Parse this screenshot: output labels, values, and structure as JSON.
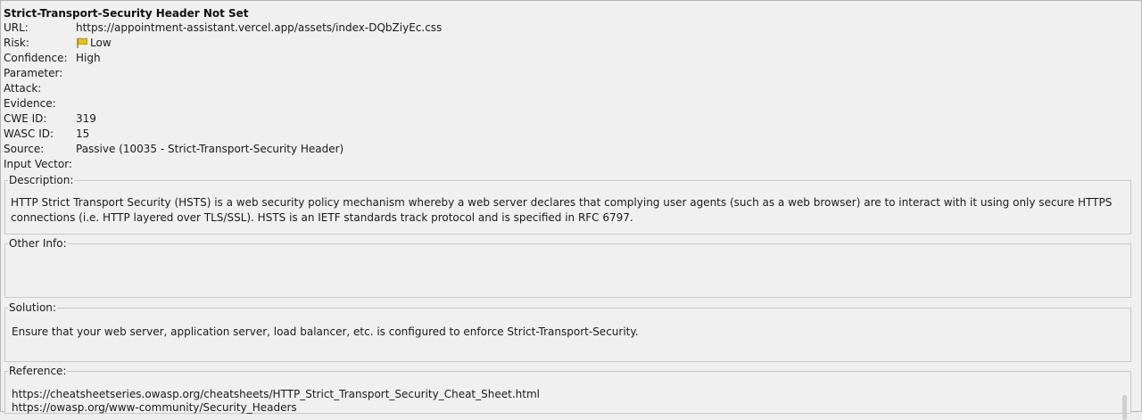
{
  "alert": {
    "title": "Strict-Transport-Security Header Not Set",
    "fields": [
      {
        "label": "URL:",
        "value": "https://appointment-assistant.vercel.app/assets/index-DQbZiyEc.css"
      },
      {
        "label": "Risk:",
        "value": "Low",
        "icon": "yellow-flag-icon"
      },
      {
        "label": "Confidence:",
        "value": "High"
      },
      {
        "label": "Parameter:",
        "value": ""
      },
      {
        "label": "Attack:",
        "value": ""
      },
      {
        "label": "Evidence:",
        "value": ""
      },
      {
        "label": "CWE ID:",
        "value": "319"
      },
      {
        "label": "WASC ID:",
        "value": "15"
      },
      {
        "label": "Source:",
        "value": "Passive (10035 - Strict-Transport-Security Header)"
      },
      {
        "label": "Input Vector:",
        "value": ""
      }
    ],
    "description": {
      "label": "Description:",
      "text": "HTTP Strict Transport Security (HSTS) is a web security policy mechanism whereby a web server declares that complying user agents (such as a web browser) are to interact with it using only secure HTTPS connections (i.e. HTTP layered over TLS/SSL). HSTS is an IETF standards track protocol and is specified in RFC 6797."
    },
    "other_info": {
      "label": "Other Info:",
      "text": ""
    },
    "solution": {
      "label": "Solution:",
      "text": "Ensure that your web server, application server, load balancer, etc. is configured to enforce Strict-Transport-Security."
    },
    "reference": {
      "label": "Reference:",
      "lines": [
        "https://cheatsheetseries.owasp.org/cheatsheets/HTTP_Strict_Transport_Security_Cheat_Sheet.html",
        "https://owasp.org/www-community/Security_Headers"
      ]
    }
  },
  "colors": {
    "flag": "#e8c21a",
    "flag_outline": "#a88a00"
  }
}
